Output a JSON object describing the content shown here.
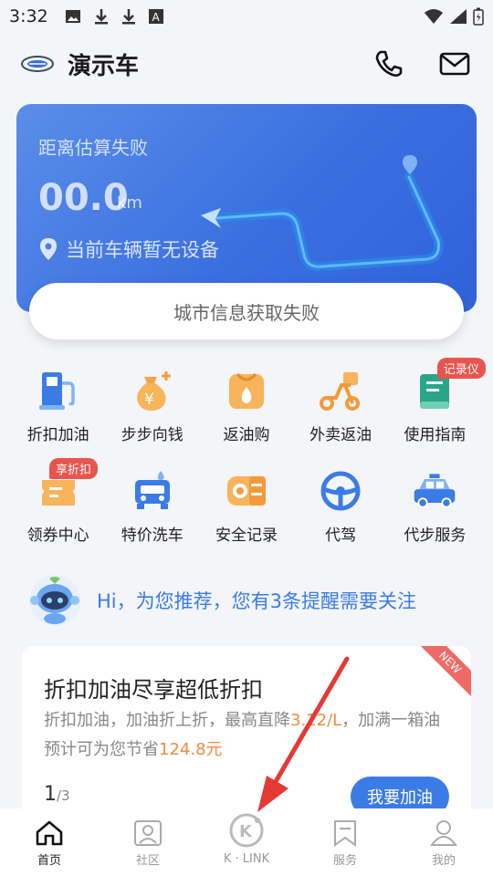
{
  "status_bar": {
    "time": "3:32"
  },
  "header": {
    "title": "演示车"
  },
  "vehicle_card": {
    "distance_title": "距离估算失败",
    "distance_value": "00.0",
    "distance_unit": "km",
    "device_status": "当前车辆暂无设备",
    "city_info": "城市信息获取失败"
  },
  "services_row1": [
    {
      "label": "折扣加油",
      "icon": "fuel-pump-icon"
    },
    {
      "label": "步步向钱",
      "icon": "money-bag-icon"
    },
    {
      "label": "返油购",
      "icon": "oil-bag-icon"
    },
    {
      "label": "外卖返油",
      "icon": "scooter-icon"
    },
    {
      "label": "使用指南",
      "icon": "guide-book-icon",
      "badge": "记录仪"
    }
  ],
  "services_row2": [
    {
      "label": "领券中心",
      "icon": "coupon-icon",
      "badge": "享折扣"
    },
    {
      "label": "特价洗车",
      "icon": "car-wash-icon"
    },
    {
      "label": "安全记录",
      "icon": "safety-record-icon"
    },
    {
      "label": "代驾",
      "icon": "steering-wheel-icon"
    },
    {
      "label": "代步服务",
      "icon": "taxi-icon"
    }
  ],
  "recommendation": {
    "text": "Hi，为您推荐，您有3条提醒需要关注"
  },
  "promo": {
    "title": "折扣加油尽享超低折扣",
    "desc_prefix": "折扣加油，加油折上折，最高直降",
    "desc_highlight1": "3.12/L",
    "desc_middle": "，加满一箱油预计可为您节省",
    "desc_highlight2": "124.8元",
    "page_current": "1",
    "page_total": "/3",
    "button_label": "我要加油",
    "ribbon": "NEW"
  },
  "tabs": [
    {
      "label": "首页",
      "icon": "home-icon",
      "active": true
    },
    {
      "label": "社区",
      "icon": "community-icon",
      "active": false
    },
    {
      "label": "K · LINK",
      "icon": "klink-icon",
      "active": false
    },
    {
      "label": "服务",
      "icon": "service-bookmark-icon",
      "active": false
    },
    {
      "label": "我的",
      "icon": "profile-icon",
      "active": false
    }
  ],
  "colors": {
    "accent": "#3b7be6",
    "card_blue": "#3b6fe0",
    "orange": "#f08a3c",
    "badge_red": "#e8554e"
  }
}
